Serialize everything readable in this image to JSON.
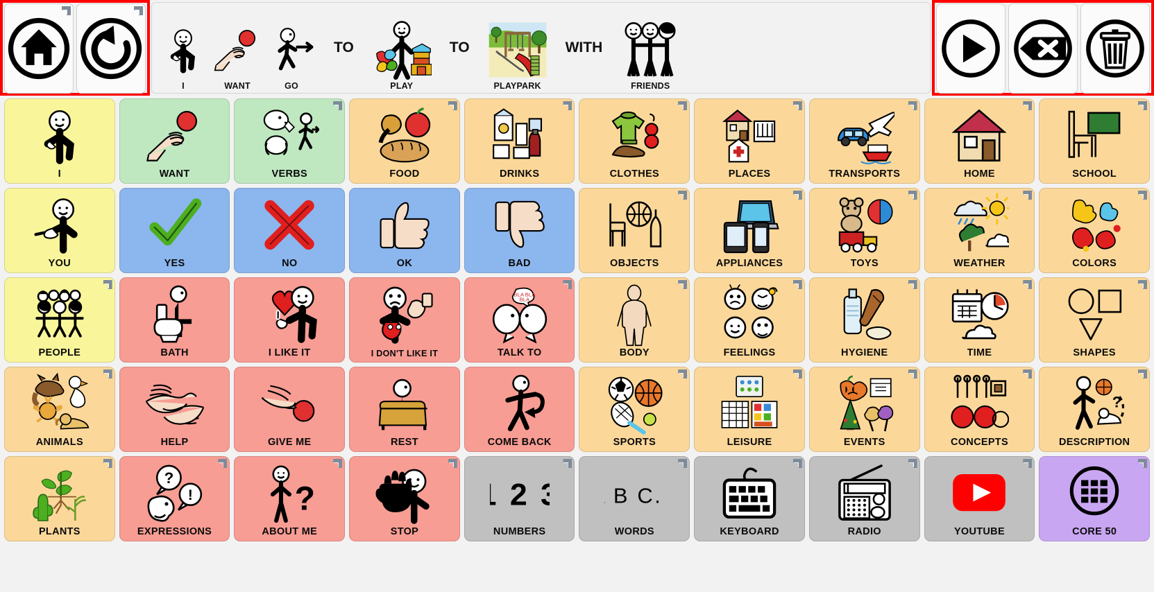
{
  "nav": {
    "left_buttons": [
      {
        "name": "home-button",
        "icon": "home-icon"
      },
      {
        "name": "back-button",
        "icon": "undo-arrow-icon"
      }
    ],
    "right_buttons": [
      {
        "name": "play-button",
        "icon": "play-icon"
      },
      {
        "name": "backspace-button",
        "icon": "backspace-x-icon"
      },
      {
        "name": "clear-button",
        "icon": "trash-can-icon"
      }
    ],
    "highlight_color": "#ff0000"
  },
  "sentence": {
    "items": [
      {
        "kind": "symbol",
        "label": "I",
        "icon": "person-pointing-self-icon"
      },
      {
        "kind": "symbol",
        "label": "WANT",
        "icon": "hand-reaching-ball-icon"
      },
      {
        "kind": "symbol",
        "label": "GO",
        "icon": "walking-person-arrow-icon"
      },
      {
        "kind": "word",
        "label": "TO"
      },
      {
        "kind": "symbol",
        "label": "PLAY",
        "icon": "child-toys-icon"
      },
      {
        "kind": "word",
        "label": "TO"
      },
      {
        "kind": "symbol",
        "label": "PLAYPARK",
        "icon": "playground-slide-swing-icon"
      },
      {
        "kind": "word",
        "label": "WITH"
      },
      {
        "kind": "symbol",
        "label": "FRIENDS",
        "icon": "three-people-icon"
      }
    ]
  },
  "grid": {
    "columns": 10,
    "cells": [
      {
        "label": "I",
        "color": "yellow",
        "icon": "person-pointing-self-icon",
        "fold": false
      },
      {
        "label": "WANT",
        "color": "green",
        "icon": "hand-reaching-ball-icon",
        "fold": false
      },
      {
        "label": "VERBS",
        "color": "green",
        "icon": "verbs-actions-icon",
        "fold": true
      },
      {
        "label": "FOOD",
        "color": "orange",
        "icon": "food-icon",
        "fold": true
      },
      {
        "label": "DRINKS",
        "color": "orange",
        "icon": "drinks-icon",
        "fold": true
      },
      {
        "label": "CLOTHES",
        "color": "orange",
        "icon": "clothes-icon",
        "fold": true
      },
      {
        "label": "PLACES",
        "color": "orange",
        "icon": "places-icon",
        "fold": true
      },
      {
        "label": "TRANSPORTS",
        "color": "orange",
        "icon": "transports-icon",
        "fold": true
      },
      {
        "label": "HOME",
        "color": "orange",
        "icon": "house-icon",
        "fold": true
      },
      {
        "label": "SCHOOL",
        "color": "orange",
        "icon": "school-desk-board-icon",
        "fold": true
      },
      {
        "label": "YOU",
        "color": "yellow",
        "icon": "person-pointing-you-icon",
        "fold": false
      },
      {
        "label": "YES",
        "color": "blue",
        "icon": "green-check-icon",
        "fold": false
      },
      {
        "label": "NO",
        "color": "blue",
        "icon": "red-cross-icon",
        "fold": false
      },
      {
        "label": "OK",
        "color": "blue",
        "icon": "thumbs-up-icon",
        "fold": false
      },
      {
        "label": "BAD",
        "color": "blue",
        "icon": "thumbs-down-icon",
        "fold": false
      },
      {
        "label": "OBJECTS",
        "color": "orange",
        "icon": "objects-chair-ball-icon",
        "fold": true
      },
      {
        "label": "APPLIANCES",
        "color": "orange",
        "icon": "appliances-devices-icon",
        "fold": true
      },
      {
        "label": "TOYS",
        "color": "orange",
        "icon": "toys-icon",
        "fold": true
      },
      {
        "label": "WEATHER",
        "color": "orange",
        "icon": "weather-icon",
        "fold": true
      },
      {
        "label": "COLORS",
        "color": "orange",
        "icon": "colors-paint-icon",
        "fold": true
      },
      {
        "label": "PEOPLE",
        "color": "yellow",
        "icon": "people-group-icon",
        "fold": true
      },
      {
        "label": "BATH",
        "color": "red",
        "icon": "toilet-person-icon",
        "fold": false
      },
      {
        "label": "I LIKE IT",
        "color": "red",
        "icon": "heart-thumbs-up-icon",
        "fold": false
      },
      {
        "label": "I DON'T LIKE IT",
        "color": "red",
        "icon": "sad-thumbs-down-icon",
        "fold": false
      },
      {
        "label": "TALK TO",
        "color": "red",
        "icon": "two-heads-talking-icon",
        "fold": true
      },
      {
        "label": "BODY",
        "color": "orange",
        "icon": "body-figure-icon",
        "fold": true
      },
      {
        "label": "FEELINGS",
        "color": "orange",
        "icon": "feelings-faces-icon",
        "fold": true
      },
      {
        "label": "HYGIENE",
        "color": "orange",
        "icon": "hygiene-comb-soap-icon",
        "fold": true
      },
      {
        "label": "TIME",
        "color": "orange",
        "icon": "time-calendar-clock-icon",
        "fold": true
      },
      {
        "label": "SHAPES",
        "color": "orange",
        "icon": "shapes-icon",
        "fold": true
      },
      {
        "label": "ANIMALS",
        "color": "orange",
        "icon": "animals-icon",
        "fold": true
      },
      {
        "label": "HELP",
        "color": "red",
        "icon": "helping-hands-icon",
        "fold": false
      },
      {
        "label": "GIVE ME",
        "color": "red",
        "icon": "hand-giving-ball-icon",
        "fold": false
      },
      {
        "label": "REST",
        "color": "red",
        "icon": "person-resting-sofa-icon",
        "fold": false
      },
      {
        "label": "COME BACK",
        "color": "red",
        "icon": "person-turning-back-icon",
        "fold": false
      },
      {
        "label": "SPORTS",
        "color": "orange",
        "icon": "sports-balls-racket-icon",
        "fold": true
      },
      {
        "label": "LEISURE",
        "color": "orange",
        "icon": "leisure-games-icon",
        "fold": true
      },
      {
        "label": "EVENTS",
        "color": "orange",
        "icon": "events-icon",
        "fold": true
      },
      {
        "label": "CONCEPTS",
        "color": "orange",
        "icon": "concepts-icon",
        "fold": true
      },
      {
        "label": "DESCRIPTION",
        "color": "orange",
        "icon": "description-icon",
        "fold": true
      },
      {
        "label": "PLANTS",
        "color": "orange",
        "icon": "plants-icon",
        "fold": true
      },
      {
        "label": "EXPRESSIONS",
        "color": "red",
        "icon": "expressions-bubbles-icon",
        "fold": true
      },
      {
        "label": "ABOUT ME",
        "color": "red",
        "icon": "person-question-icon",
        "fold": true
      },
      {
        "label": "STOP",
        "color": "red",
        "icon": "hand-stop-icon",
        "fold": true
      },
      {
        "label": "NUMBERS",
        "color": "grey",
        "icon": "numbers-123-icon",
        "fold": true
      },
      {
        "label": "WORDS",
        "color": "grey",
        "icon": "abc-letters-icon",
        "fold": true
      },
      {
        "label": "KEYBOARD",
        "color": "grey",
        "icon": "keyboard-icon",
        "fold": true
      },
      {
        "label": "RADIO",
        "color": "grey",
        "icon": "radio-icon",
        "fold": true
      },
      {
        "label": "YOUTUBE",
        "color": "grey",
        "icon": "youtube-logo-icon",
        "fold": true
      },
      {
        "label": "CORE 50",
        "color": "purple",
        "icon": "core-grid-circle-icon",
        "fold": true
      }
    ]
  },
  "palette": {
    "yellow": "#f9f59b",
    "green": "#bfe8c0",
    "orange": "#fbd89a",
    "blue": "#8cb6ee",
    "red": "#f79d94",
    "grey": "#c0c0c0",
    "purple": "#c9a6f2",
    "background": "#f2f2f2",
    "highlight": "#ff0000"
  }
}
